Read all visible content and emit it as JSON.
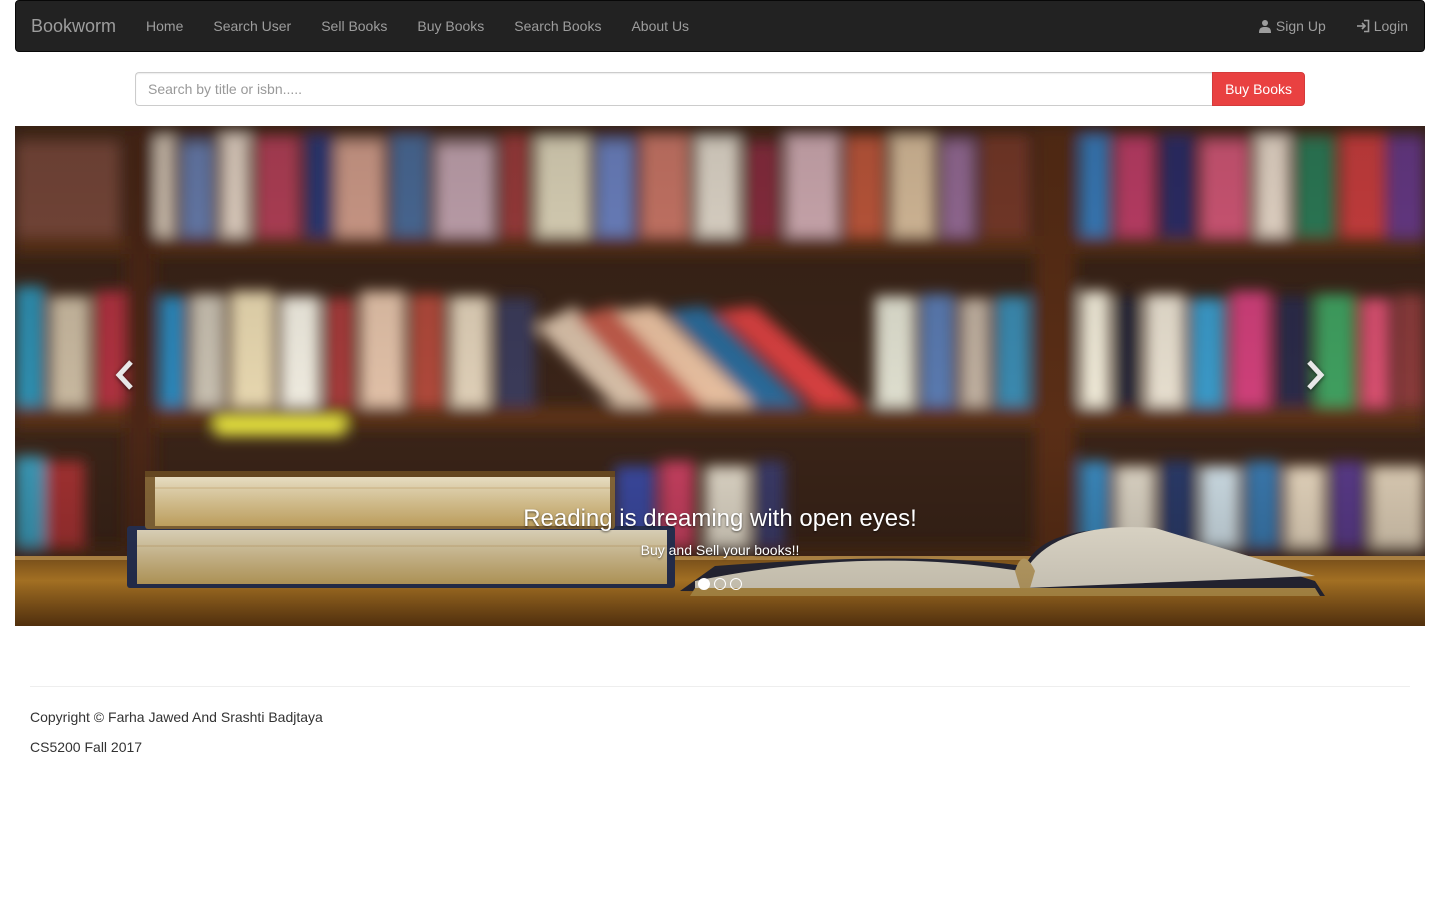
{
  "navbar": {
    "brand": "Bookworm",
    "items": [
      {
        "label": "Home"
      },
      {
        "label": "Search User"
      },
      {
        "label": "Sell Books"
      },
      {
        "label": "Buy Books"
      },
      {
        "label": "Search Books"
      },
      {
        "label": "About Us"
      }
    ],
    "right": {
      "signup": {
        "label": "Sign Up",
        "icon": "user-icon"
      },
      "login": {
        "label": "Login",
        "icon": "login-icon"
      }
    }
  },
  "search": {
    "placeholder": "Search by title or isbn.....",
    "value": "",
    "button_label": "Buy Books",
    "button_color": "#e94141"
  },
  "carousel": {
    "title": "Reading is dreaming with open eyes!",
    "subtitle": "Buy and Sell your books!!",
    "slide_count": 3,
    "active_index": 0,
    "prev_icon": "chevron-left-icon",
    "next_icon": "chevron-right-icon"
  },
  "footer": {
    "copyright": "Copyright © Farha Jawed And Srashti Badjtaya",
    "course": "CS5200 Fall 2017"
  },
  "colors": {
    "navbar_bg": "#222222",
    "nav_text": "#9d9d9d",
    "accent": "#e94141"
  }
}
